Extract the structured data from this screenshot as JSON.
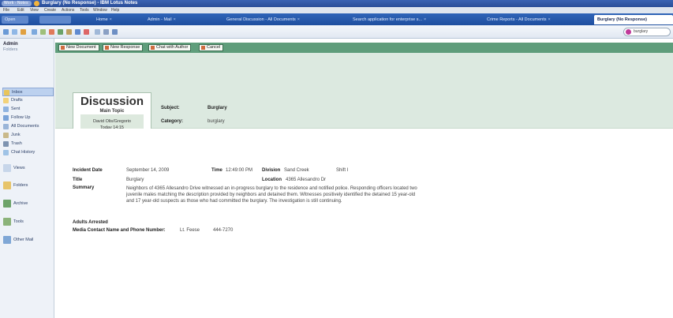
{
  "window": {
    "title": "Burglary (No Response) - IBM Lotus Notes",
    "app_button": "Work - Notes"
  },
  "menu": [
    "File",
    "Edit",
    "View",
    "Create",
    "Actions",
    "Tools",
    "Window",
    "Help"
  ],
  "tabs": [
    {
      "label": "Open"
    },
    {
      "label": "Home"
    },
    {
      "label": "Admin - Mail"
    },
    {
      "label": "General Discussion - All Documents"
    },
    {
      "label": "Search application for enterprise s..."
    },
    {
      "label": "Crime Reports - All Documents"
    },
    {
      "label": "Burglary (No Response)"
    }
  ],
  "search": {
    "value": "burglary"
  },
  "nav": {
    "header": "Admin",
    "subheader": "Folders",
    "items": [
      {
        "label": "Inbox",
        "icon": "inbox-icon",
        "color": "#e8c45b"
      },
      {
        "label": "Drafts",
        "icon": "drafts-icon",
        "color": "#f2d27a"
      },
      {
        "label": "Sent",
        "icon": "sent-icon",
        "color": "#8fb3e0"
      },
      {
        "label": "Follow Up",
        "icon": "follow-up-icon",
        "color": "#7aa3d8"
      },
      {
        "label": "All Documents",
        "icon": "all-documents-icon",
        "color": "#9ab5d8"
      },
      {
        "label": "Junk",
        "icon": "junk-icon",
        "color": "#c9b98a"
      },
      {
        "label": "Trash",
        "icon": "trash-icon",
        "color": "#7d93b0"
      },
      {
        "label": "Chat History",
        "icon": "chat-icon",
        "color": "#9fc3e6"
      },
      {
        "label": "Views",
        "icon": "views-icon",
        "color": "#c7d6ea"
      },
      {
        "label": "Folders",
        "icon": "folders-icon",
        "color": "#e7c46a"
      },
      {
        "label": "Archive",
        "icon": "archive-icon",
        "color": "#6da36a"
      },
      {
        "label": "Tools",
        "icon": "tools-icon",
        "color": "#8bb37a"
      },
      {
        "label": "Other Mail",
        "icon": "other-mail-icon",
        "color": "#7fa7d6"
      }
    ]
  },
  "actions": [
    {
      "label": "New Document"
    },
    {
      "label": "New Response"
    },
    {
      "label": "Chat with Author"
    },
    {
      "label": "Cancel"
    }
  ],
  "discussion": {
    "title": "Discussion",
    "subtitle": "Main Topic",
    "author": "David Olis/Gregorio",
    "date": "Today 14:15",
    "subject_label": "Subject:",
    "subject": "Burglary",
    "category_label": "Category:",
    "category": "burglary"
  },
  "incident": {
    "date_label": "Incident Date",
    "date": "September 14, 2009",
    "time_label": "Time",
    "time": "12:49:00 PM",
    "division_label": "Division",
    "division": "Sand Creek",
    "shift": "Shift I",
    "title_label": "Title",
    "title": "Burglary",
    "location_label": "Location",
    "location": "4365 Allesandro Dr",
    "summary_label": "Summary",
    "summary": "Neighbors of 4365 Allesandro Drive witnessed an in-progress burglary to the residence and notified police. Responding officers located two juvenile males matching the description provided by neighbors and detained them. Witnesses positively identified the detained 15 year-old and 17 year-old suspects as those who had committed the burglary. The investigation is still continuing.",
    "adults_label": "Adults Arrested",
    "media_label": "Media Contact Name and Phone Number:",
    "media_name": "Lt. Feese",
    "media_phone": "444-7270"
  }
}
